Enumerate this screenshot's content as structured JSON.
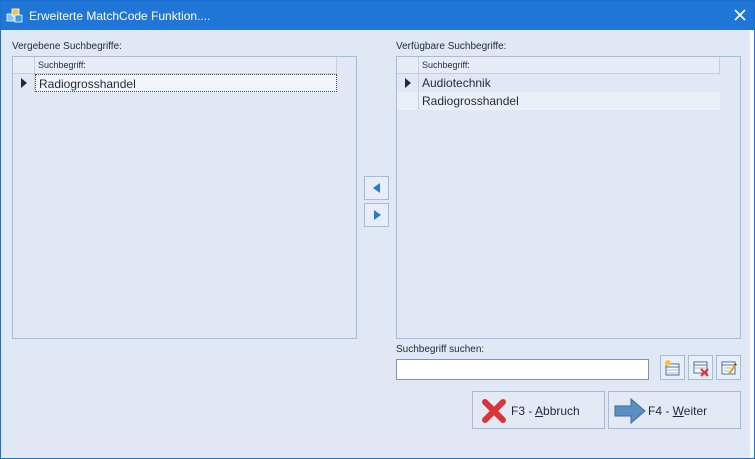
{
  "window": {
    "title": "Erweiterte MatchCode Funktion....",
    "icon": "app-cubes-icon",
    "close_icon": "close-icon"
  },
  "left_panel": {
    "label": "Vergebene Suchbegriffe:",
    "column_header": "Suchbegriff:",
    "rows": [
      "Radiogrosshandel"
    ]
  },
  "right_panel": {
    "label": "Verfügbare Suchbegriffe:",
    "column_header": "Suchbegriff:",
    "rows": [
      "Audiotechnik",
      "Radiogrosshandel"
    ]
  },
  "move_buttons": {
    "left_icon": "arrow-left-icon",
    "right_icon": "arrow-right-icon"
  },
  "search": {
    "label": "Suchbegriff suchen:",
    "value": "",
    "placeholder": ""
  },
  "toolbar_icons": [
    "new-entry-icon",
    "delete-entry-icon",
    "edit-entry-icon"
  ],
  "actions": {
    "cancel_prefix": "F3 - ",
    "cancel_hotkey": "A",
    "cancel_rest": "bbruch",
    "next_prefix": "F4 - ",
    "next_hotkey": "W",
    "next_rest": "eiter"
  },
  "colors": {
    "titlebar": "#1f76d6",
    "dialog_bg": "#dfe8f4",
    "accent_arrow": "#2b78d0",
    "cancel_red": "#d9343a"
  }
}
